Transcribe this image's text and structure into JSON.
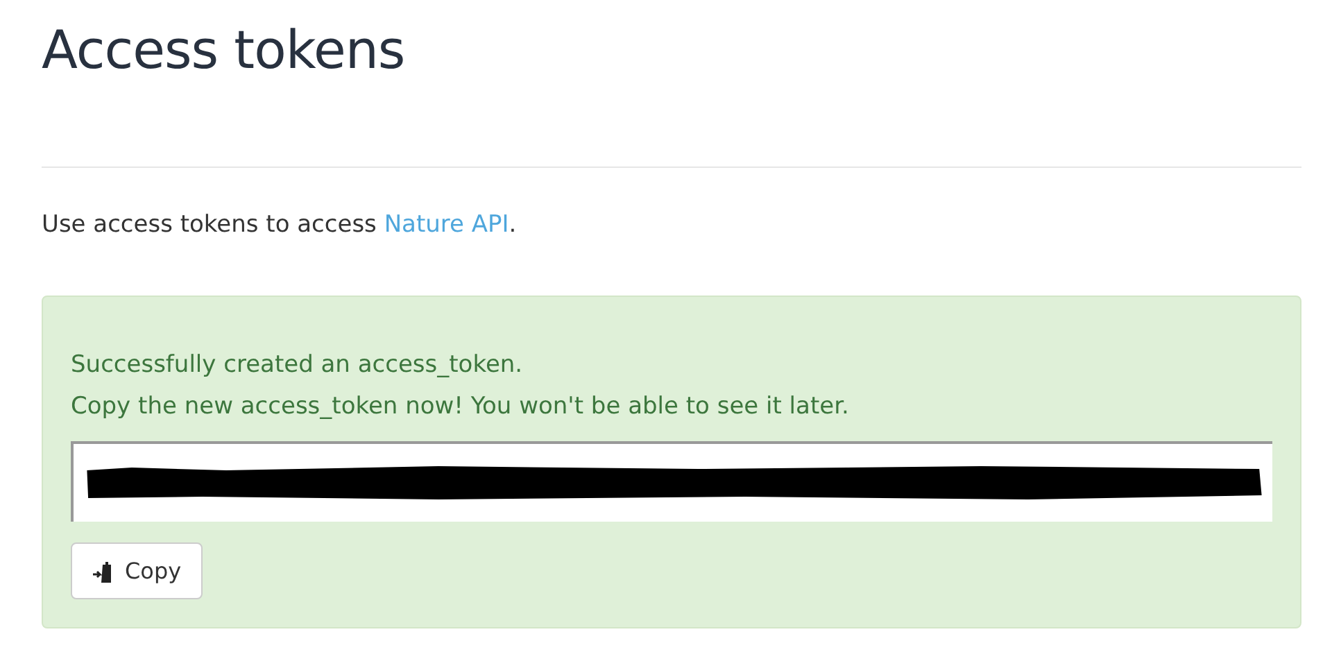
{
  "page_title": "Access tokens",
  "intro": {
    "before": "Use access tokens to access ",
    "link": "Nature API",
    "after": "."
  },
  "alert": {
    "messages": [
      "Successfully created an access_token.",
      "Copy the new access_token now! You won't be able to see it later."
    ],
    "token_field": {
      "redacted": true
    },
    "copy_button": {
      "label": "Copy"
    }
  }
}
